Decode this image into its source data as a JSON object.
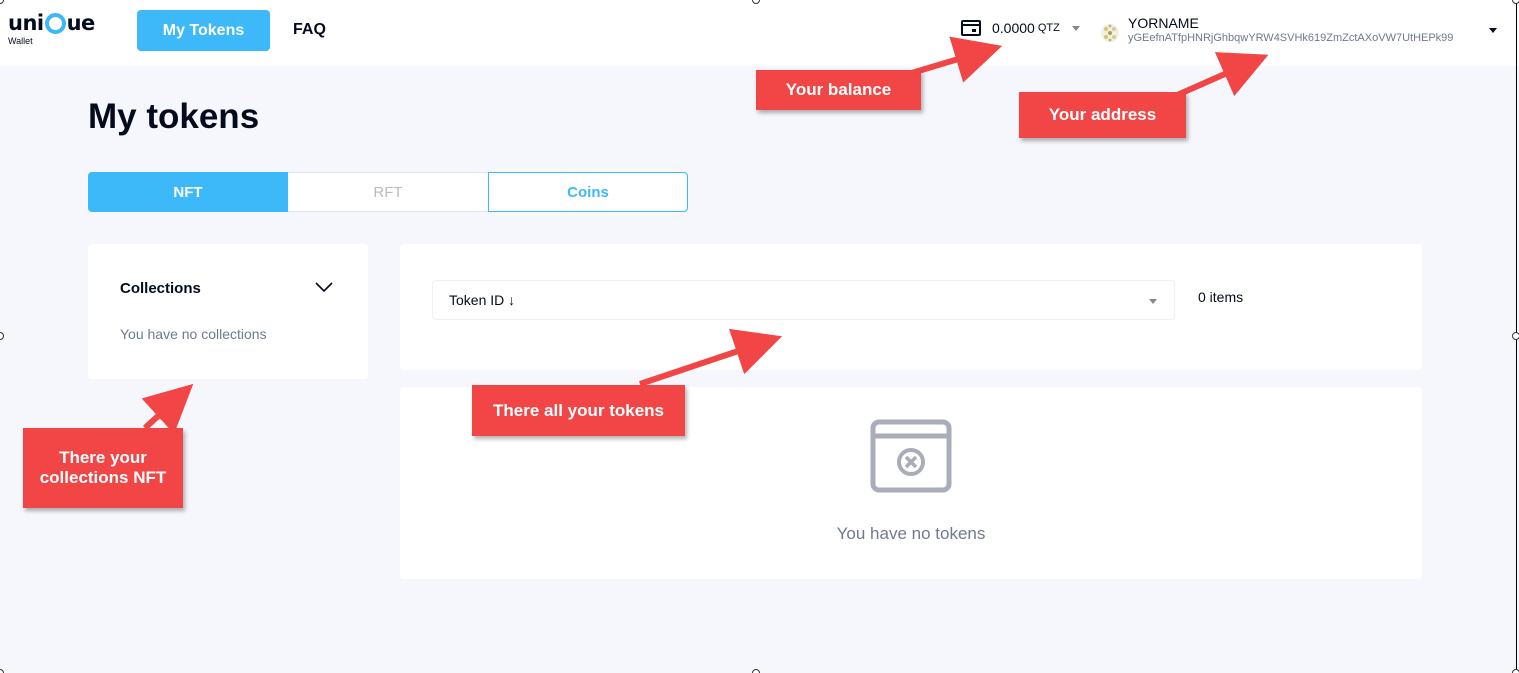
{
  "header": {
    "logo_text_left": "uni",
    "logo_text_right": "ue",
    "logo_sub": "Wallet",
    "nav_active": "My Tokens",
    "nav_faq": "FAQ",
    "balance_value": "0.0000",
    "balance_unit": "QTZ",
    "account_name": "YORNAME",
    "account_address": "yGEefnATfpHNRjGhbqwYRW4SVHk619ZmZctAXoVW7UtHEPk99"
  },
  "page": {
    "title": "My tokens",
    "tabs": [
      {
        "label": "NFT"
      },
      {
        "label": "RFT"
      },
      {
        "label": "Coins"
      }
    ]
  },
  "collections": {
    "title": "Collections",
    "empty_text": "You have no collections"
  },
  "filter": {
    "sort_label": "Token ID ↓",
    "items_count": "0 items"
  },
  "tokens": {
    "empty_text": "You have no tokens"
  },
  "callouts": {
    "balance": "Your balance",
    "address": "Your address",
    "collections": "There your collections NFT",
    "tokens": "There all your tokens"
  },
  "colors": {
    "accent": "#3db9f9",
    "callout": "#f24545",
    "background": "#f5f7fc"
  }
}
